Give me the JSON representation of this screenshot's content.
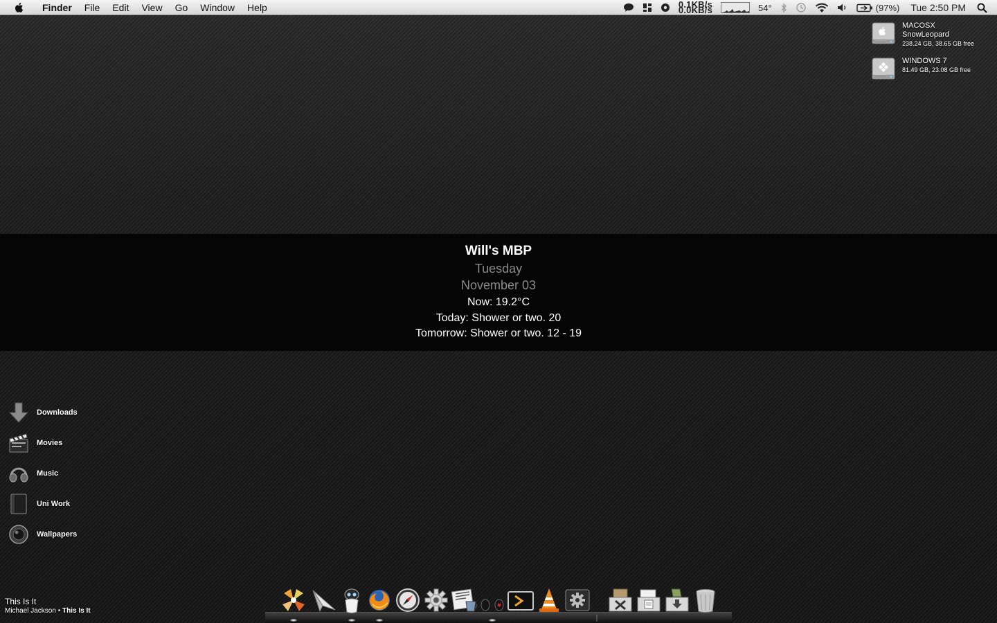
{
  "menubar": {
    "app_name": "Finder",
    "menus": [
      "File",
      "Edit",
      "View",
      "Go",
      "Window",
      "Help"
    ],
    "net_up": "0.1KB/s",
    "net_down": "0.0KB/s",
    "temperature": "54°",
    "battery": "(97%)",
    "clock": "Tue 2:50 PM"
  },
  "drives": [
    {
      "line1": "MACOSX",
      "line2": "SnowLeopard",
      "line3": "238.24 GB, 38.65 GB free"
    },
    {
      "line1": "WINDOWS 7",
      "line2": "81.49 GB, 23.08 GB free"
    }
  ],
  "widget": {
    "computer_name": "Will's MBP",
    "day": "Tuesday",
    "date": "November 03",
    "now": "Now: 19.2°C",
    "today": "Today: Shower or two.  20",
    "tomorrow": "Tomorrow: Shower or two.  12 - 19"
  },
  "folders": [
    {
      "label": "Downloads",
      "icon": "downloads-arrow-icon"
    },
    {
      "label": "Movies",
      "icon": "clapperboard-icon"
    },
    {
      "label": "Music",
      "icon": "headphones-icon"
    },
    {
      "label": "Uni Work",
      "icon": "folder-book-icon"
    },
    {
      "label": "Wallpapers",
      "icon": "lens-icon"
    }
  ],
  "now_playing": {
    "track": "This Is It",
    "artist": "Michael Jackson",
    "separator": " • ",
    "album": "This Is It"
  },
  "dock": {
    "apps": [
      "pinwheel-app-icon",
      "mail-plane-icon",
      "robot-app-icon",
      "firefox-icon",
      "safari-compass-icon",
      "system-preferences-gear-icon",
      "news-reader-icon",
      "headphones-app-icon",
      "terminal-icon",
      "vlc-cone-icon",
      "gear-utility-icon"
    ],
    "stacks": [
      "applications-stack-icon",
      "documents-stack-icon",
      "downloads-stack-icon",
      "trash-icon"
    ]
  }
}
